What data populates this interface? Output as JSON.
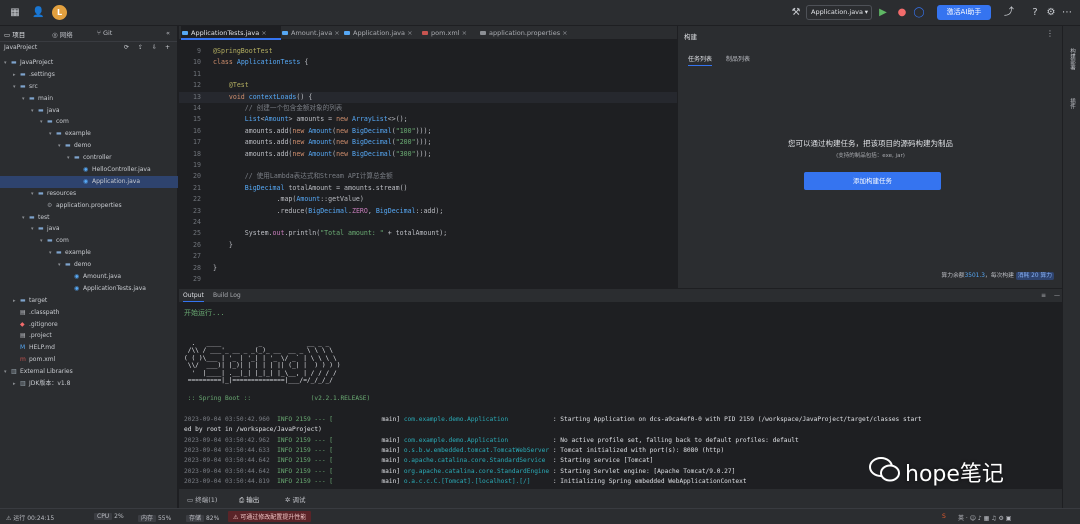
{
  "header": {
    "user_initial": "L",
    "run_config": "Application.java",
    "ai_button": "激活AI助手"
  },
  "sidebar": {
    "tabs": [
      "项目",
      "网络",
      "Git"
    ],
    "project_root": "JavaProject",
    "tree": [
      {
        "label": "JavaProject",
        "depth": 0,
        "arrow": "▾",
        "icon": "folder",
        "selected": false
      },
      {
        "label": ".settings",
        "depth": 1,
        "arrow": "▸",
        "icon": "folder",
        "selected": false
      },
      {
        "label": "src",
        "depth": 1,
        "arrow": "▾",
        "icon": "folder",
        "selected": false
      },
      {
        "label": "main",
        "depth": 2,
        "arrow": "▾",
        "icon": "folder",
        "selected": false
      },
      {
        "label": "java",
        "depth": 3,
        "arrow": "▾",
        "icon": "folder",
        "selected": false
      },
      {
        "label": "com",
        "depth": 4,
        "arrow": "▾",
        "icon": "folder",
        "selected": false
      },
      {
        "label": "example",
        "depth": 5,
        "arrow": "▾",
        "icon": "folder",
        "selected": false
      },
      {
        "label": "demo",
        "depth": 6,
        "arrow": "▾",
        "icon": "folder",
        "selected": false
      },
      {
        "label": "controller",
        "depth": 7,
        "arrow": "▾",
        "icon": "folder",
        "selected": false
      },
      {
        "label": "HelloController.java",
        "depth": 8,
        "arrow": "",
        "icon": "java",
        "selected": false
      },
      {
        "label": "Application.java",
        "depth": 8,
        "arrow": "",
        "icon": "java",
        "selected": true
      },
      {
        "label": "resources",
        "depth": 3,
        "arrow": "▾",
        "icon": "folder",
        "selected": false
      },
      {
        "label": "application.properties",
        "depth": 4,
        "arrow": "",
        "icon": "gear",
        "selected": false
      },
      {
        "label": "test",
        "depth": 2,
        "arrow": "▾",
        "icon": "folder",
        "selected": false
      },
      {
        "label": "java",
        "depth": 3,
        "arrow": "▾",
        "icon": "folder",
        "selected": false
      },
      {
        "label": "com",
        "depth": 4,
        "arrow": "▾",
        "icon": "folder",
        "selected": false
      },
      {
        "label": "example",
        "depth": 5,
        "arrow": "▾",
        "icon": "folder",
        "selected": false
      },
      {
        "label": "demo",
        "depth": 6,
        "arrow": "▾",
        "icon": "folder",
        "selected": false
      },
      {
        "label": "Amount.java",
        "depth": 7,
        "arrow": "",
        "icon": "java",
        "selected": false
      },
      {
        "label": "ApplicationTests.java",
        "depth": 7,
        "arrow": "",
        "icon": "java",
        "selected": false
      },
      {
        "label": "target",
        "depth": 1,
        "arrow": "▸",
        "icon": "folder",
        "selected": false
      },
      {
        "label": ".classpath",
        "depth": 1,
        "arrow": "",
        "icon": "file",
        "selected": false
      },
      {
        "label": ".gitignore",
        "depth": 1,
        "arrow": "",
        "icon": "git",
        "selected": false
      },
      {
        "label": ".project",
        "depth": 1,
        "arrow": "",
        "icon": "file",
        "selected": false
      },
      {
        "label": "HELP.md",
        "depth": 1,
        "arrow": "",
        "icon": "md",
        "selected": false
      },
      {
        "label": "pom.xml",
        "depth": 1,
        "arrow": "",
        "icon": "maven",
        "selected": false
      },
      {
        "label": "External Libraries",
        "depth": 0,
        "arrow": "▾",
        "icon": "lib",
        "selected": false
      },
      {
        "label": "JDK版本：v1.8",
        "depth": 1,
        "arrow": "▸",
        "icon": "lib",
        "selected": false
      }
    ]
  },
  "editor": {
    "tabs": [
      {
        "label": "ApplicationTests.java",
        "active": true,
        "color": "#56a8f5"
      },
      {
        "label": "Amount.java",
        "active": false,
        "color": "#56a8f5"
      },
      {
        "label": "Application.java",
        "active": false,
        "color": "#56a8f5"
      },
      {
        "label": "pom.xml",
        "active": false,
        "color": "#c75450"
      },
      {
        "label": "application.properties",
        "active": false,
        "color": "#8c8f94"
      }
    ],
    "lines": [
      {
        "n": "9",
        "html": "<span class=\"an\">@SpringBootTest</span>"
      },
      {
        "n": "10",
        "html": "<span class=\"kw\">class</span> <span class=\"ty\">ApplicationTests</span> {"
      },
      {
        "n": "11",
        "html": ""
      },
      {
        "n": "12",
        "html": "    <span class=\"an\">@Test</span>"
      },
      {
        "n": "13",
        "html": "    <span class=\"kw\">void</span> <span class=\"ty\">contextLoads</span>() {",
        "cur": true
      },
      {
        "n": "14",
        "html": "        <span class=\"cm\">// 创建一个包含金额对象的列表</span>"
      },
      {
        "n": "15",
        "html": "        <span class=\"ty\">List</span>&lt;<span class=\"ty\">Amount</span>&gt; amounts = <span class=\"kw\">new</span> <span class=\"ty\">ArrayList</span>&lt;&gt;();"
      },
      {
        "n": "16",
        "html": "        amounts.add(<span class=\"kw\">new</span> <span class=\"ty\">Amount</span>(<span class=\"kw\">new</span> <span class=\"ty\">BigDecimal</span>(<span class=\"st\">\"100\"</span>)));"
      },
      {
        "n": "17",
        "html": "        amounts.add(<span class=\"kw\">new</span> <span class=\"ty\">Amount</span>(<span class=\"kw\">new</span> <span class=\"ty\">BigDecimal</span>(<span class=\"st\">\"200\"</span>)));"
      },
      {
        "n": "18",
        "html": "        amounts.add(<span class=\"kw\">new</span> <span class=\"ty\">Amount</span>(<span class=\"kw\">new</span> <span class=\"ty\">BigDecimal</span>(<span class=\"st\">\"300\"</span>)));"
      },
      {
        "n": "19",
        "html": ""
      },
      {
        "n": "20",
        "html": "        <span class=\"cm\">// 使用Lambda表达式和Stream API计算总金额</span>"
      },
      {
        "n": "21",
        "html": "        <span class=\"ty\">BigDecimal</span> totalAmount = amounts.stream()"
      },
      {
        "n": "22",
        "html": "                .map(<span class=\"ty\">Amount</span>::getValue)"
      },
      {
        "n": "23",
        "html": "                .reduce(<span class=\"ty\">BigDecimal</span>.<span class=\"fn\">ZERO</span>, <span class=\"ty\">BigDecimal</span>::add);"
      },
      {
        "n": "24",
        "html": ""
      },
      {
        "n": "25",
        "html": "        System.<span class=\"fn\">out</span>.println(<span class=\"st\">\"Total amount: \"</span> + totalAmount);"
      },
      {
        "n": "26",
        "html": "    }"
      },
      {
        "n": "27",
        "html": ""
      },
      {
        "n": "28",
        "html": "}"
      },
      {
        "n": "29",
        "html": ""
      }
    ]
  },
  "build_panel": {
    "title": "构建",
    "tabs": [
      "任务列表",
      "制品列表"
    ],
    "message": "您可以通过构建任务，把该项目的源码构建为制品",
    "sub_message": "(支持的制品包括：exe, jar)",
    "button": "添加构建任务",
    "credit_label": "算力余额",
    "credit_value": "3501.3",
    "credit_each": "，每次构建",
    "credit_cost": "消耗 20 算力"
  },
  "right_strip": [
    "构建部署",
    "插件"
  ],
  "output": {
    "tabs": [
      "Output",
      "Build Log"
    ],
    "start_text": "开始运行...",
    "banner": "  .   ____          _            __ _ _\n /\\\\ / ___'_ __ _ _(_)_ __  __ _ \\ \\ \\ \\\n( ( )\\___ | '_ | '_| | '_ \\/ _` | \\ \\ \\ \\\n \\\\/  ___)| |_)| | | | | || (_| |  ) ) ) )\n  '  |____| .__|_| |_|_| |_\\__, | / / / /\n =========|_|==============|___/=/_/_/_/",
    "banner_sub": " :: Spring Boot ::                (v2.2.1.RELEASE)",
    "logs": [
      {
        "ts": "2023-09-04 03:50:42.960",
        "lv": "INFO 2159 --- [",
        "th": "           main]",
        "lg": " com.example.demo.Application            ",
        "msg": ": Starting Application on dcs-a9ca4ef0-0 with PID 2159 (/workspace/JavaProject/target/classes start"
      },
      {
        "ts": "",
        "lv": "",
        "th": "",
        "lg": "",
        "msg": "ed by root in /workspace/JavaProject)"
      },
      {
        "ts": "2023-09-04 03:50:42.962",
        "lv": "INFO 2159 --- [",
        "th": "           main]",
        "lg": " com.example.demo.Application            ",
        "msg": ": No active profile set, falling back to default profiles: default"
      },
      {
        "ts": "2023-09-04 03:50:44.633",
        "lv": "INFO 2159 --- [",
        "th": "           main]",
        "lg": " o.s.b.w.embedded.tomcat.TomcatWebServer ",
        "msg": ": Tomcat initialized with port(s): 8080 (http)"
      },
      {
        "ts": "2023-09-04 03:50:44.642",
        "lv": "INFO 2159 --- [",
        "th": "           main]",
        "lg": " o.apache.catalina.core.StandardService  ",
        "msg": ": Starting service [Tomcat]"
      },
      {
        "ts": "2023-09-04 03:50:44.642",
        "lv": "INFO 2159 --- [",
        "th": "           main]",
        "lg": " org.apache.catalina.core.StandardEngine ",
        "msg": ": Starting Servlet engine: [Apache Tomcat/9.0.27]"
      },
      {
        "ts": "2023-09-04 03:50:44.819",
        "lv": "INFO 2159 --- [",
        "th": "           main]",
        "lg": " o.a.c.c.C.[Tomcat].[localhost].[/]      ",
        "msg": ": Initializing Spring embedded WebApplicationContext"
      }
    ]
  },
  "bottom_tools": [
    "终端(1)",
    "输出",
    "调试"
  ],
  "status": {
    "run_time": "运行 00:24:15",
    "cpu_label": "CPU",
    "cpu_value": "2%",
    "mem_label": "内存",
    "mem_value": "55%",
    "disk_label": "存储",
    "disk_value": "82%",
    "warning": "可通过修改配置提升性能"
  },
  "watermark": "hope笔记"
}
